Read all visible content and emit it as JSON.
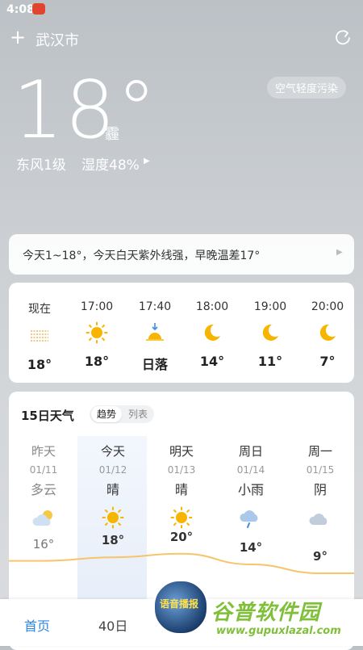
{
  "status": {
    "time": "4:08"
  },
  "header": {
    "city": "武汉市",
    "add_icon": "plus-icon",
    "refresh_icon": "refresh-icon"
  },
  "current": {
    "temp": "18°",
    "condition": "霾",
    "aqi_badge": "空气轻度污染",
    "wind": "东风1级",
    "humidity": "湿度48%"
  },
  "tip": {
    "text": "今天1~18°，今天白天紫外线强，早晚温差17°"
  },
  "hourly": [
    {
      "time": "现在",
      "icon": "haze-icon",
      "value": "18°"
    },
    {
      "time": "17:00",
      "icon": "sun-icon",
      "value": "18°"
    },
    {
      "time": "17:40",
      "icon": "sunset-icon",
      "value": "日落"
    },
    {
      "time": "18:00",
      "icon": "moon-icon",
      "value": "14°"
    },
    {
      "time": "19:00",
      "icon": "moon-icon",
      "value": "11°"
    },
    {
      "time": "20:00",
      "icon": "moon-icon",
      "value": "7°"
    }
  ],
  "forecast": {
    "title": "15日天气",
    "toggle_trend": "趋势",
    "toggle_list": "列表",
    "days": [
      {
        "name": "昨天",
        "date": "01/11",
        "weather": "多云",
        "icon": "cloudy-icon",
        "temp": "16°",
        "high": 16
      },
      {
        "name": "今天",
        "date": "01/12",
        "weather": "晴",
        "icon": "sun-icon",
        "temp": "18°",
        "high": 18
      },
      {
        "name": "明天",
        "date": "01/13",
        "weather": "晴",
        "icon": "sun-icon",
        "temp": "20°",
        "high": 20
      },
      {
        "name": "周日",
        "date": "01/14",
        "weather": "小雨",
        "icon": "rain-icon",
        "temp": "14°",
        "high": 14
      },
      {
        "name": "周一",
        "date": "01/15",
        "weather": "阴",
        "icon": "overcast-icon",
        "temp": "9°",
        "high": 9
      }
    ]
  },
  "tabs": {
    "home": "首页",
    "forty": "40日"
  },
  "voice": {
    "label": "语音播报"
  },
  "watermark": {
    "text": "谷普软件园",
    "url": "www.gupuxlazal.com"
  },
  "colors": {
    "accent": "#2a86e6",
    "sun": "#f7b500",
    "trend_line": "#f6c46a"
  }
}
